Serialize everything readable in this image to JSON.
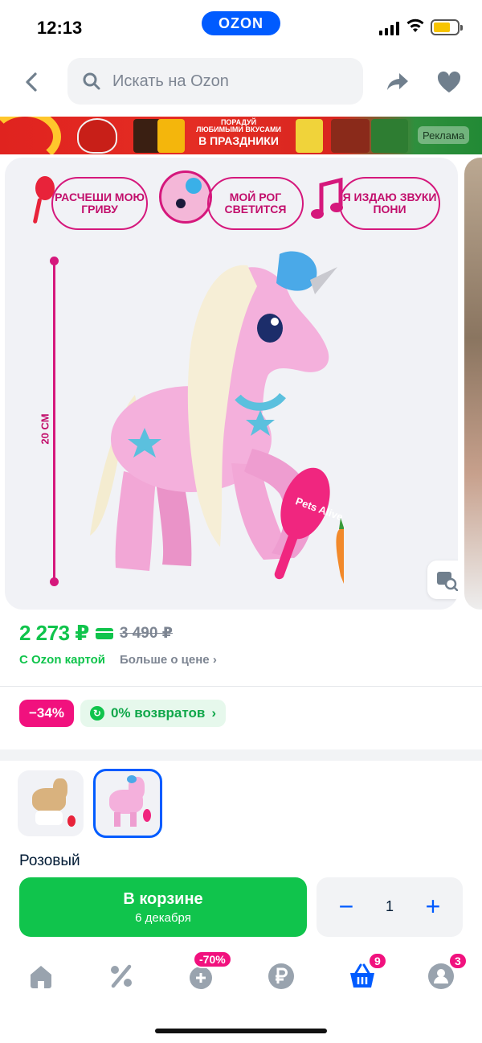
{
  "status_bar": {
    "time": "12:13",
    "brand": "OZON"
  },
  "header": {
    "search_placeholder": "Искать на Ozon"
  },
  "banner": {
    "line1": "ПОРАДУЙ",
    "line2": "ЛЮБИМЫМИ ВКУСАМИ",
    "line3": "В ПРАЗДНИКИ",
    "ad_label": "Реклама"
  },
  "product_image": {
    "features": [
      "РАСЧЕШИ МОЮ ГРИВУ",
      "МОЙ РОГ СВЕТИТСЯ",
      "Я ИЗДАЮ ЗВУКИ ПОНИ"
    ],
    "size_label": "20 СМ",
    "brush_text": "Pets Alive"
  },
  "price": {
    "current": "2 273 ₽",
    "old": "3 490 ₽",
    "card_label": "С Ozon картой",
    "more_label": "Больше о цене"
  },
  "badges": {
    "discount": "−34%",
    "returns": "0% возвратов"
  },
  "variant": {
    "selected_name": "Розовый"
  },
  "cart": {
    "button_label": "В корзине",
    "delivery": "6 декабря",
    "quantity": "1",
    "minus": "−",
    "plus": "+"
  },
  "tabbar": {
    "discount_badge": "-70%",
    "cart_badge": "9",
    "profile_badge": "3"
  },
  "colors": {
    "accent": "#005bff",
    "green": "#10c44c",
    "pink": "#f1117e",
    "magenta": "#d5187c"
  }
}
